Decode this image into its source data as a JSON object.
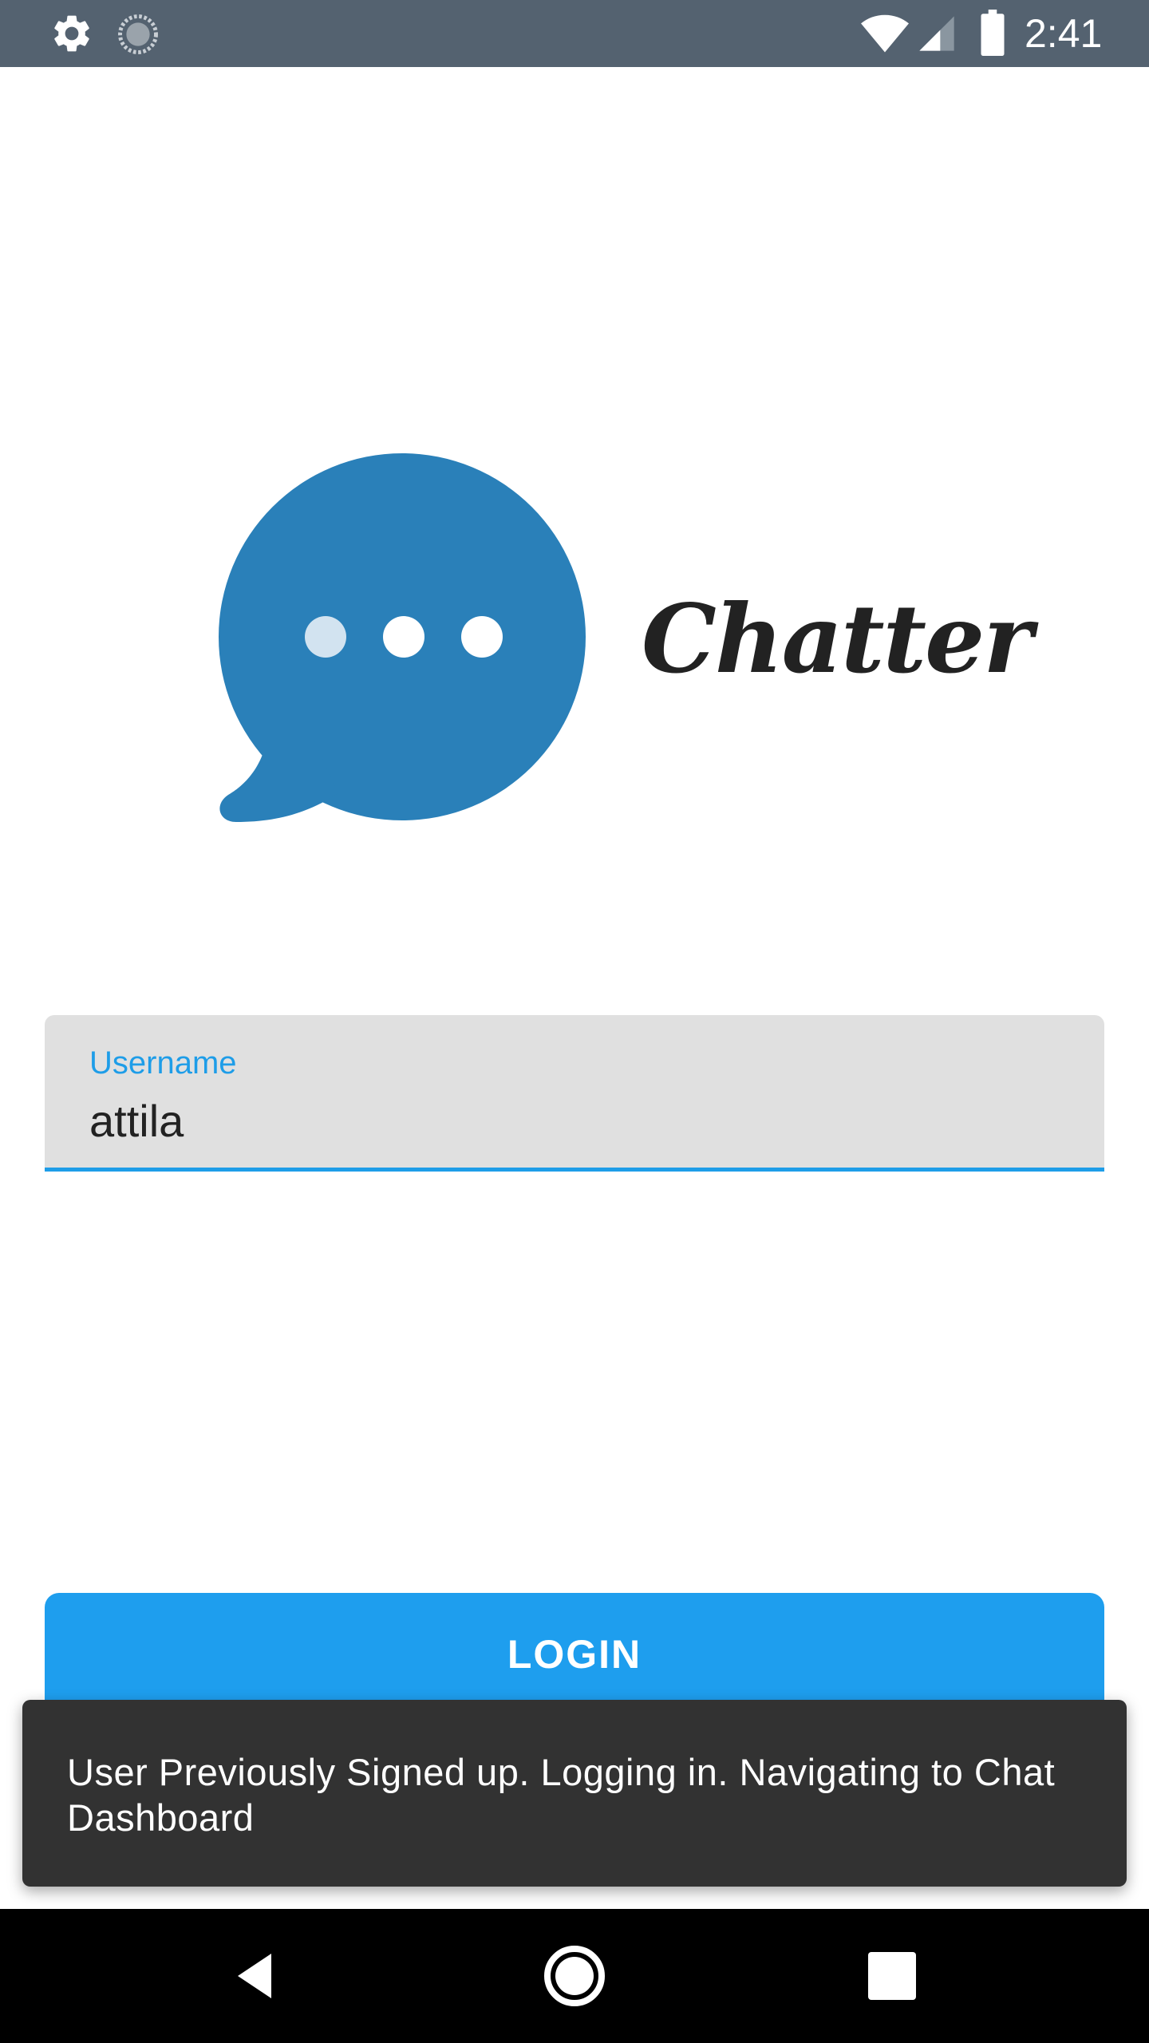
{
  "status_bar": {
    "time": "2:41",
    "left_icons": [
      "gear-icon",
      "sync-icon"
    ],
    "right_icons": [
      "wifi-icon",
      "signal-icon",
      "battery-icon"
    ],
    "background_color": "#546270"
  },
  "logo": {
    "app_name": "Chatter",
    "icon": "chat-bubble-icon",
    "icon_color": "#2a80b9"
  },
  "username_field": {
    "label": "Username",
    "value": "attila",
    "accent_color": "#1e9de8"
  },
  "login_button": {
    "label": "LOGIN",
    "color": "#1e9eee"
  },
  "snackbar": {
    "message": "User Previously Signed up. Logging in. Navigating to Chat Dashboard"
  },
  "nav_bar": {
    "icons": [
      "back-icon",
      "home-icon",
      "recents-icon"
    ]
  }
}
